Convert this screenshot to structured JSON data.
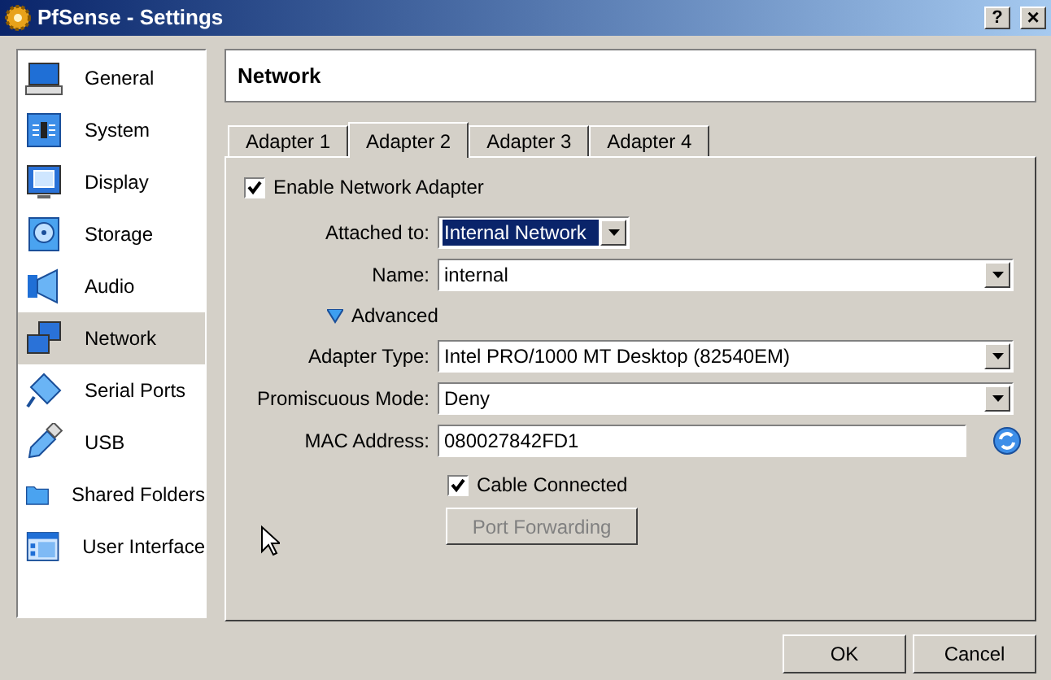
{
  "window": {
    "title": "PfSense - Settings",
    "help": "?",
    "close": "×"
  },
  "sidebar": {
    "items": [
      {
        "label": "General",
        "selected": false
      },
      {
        "label": "System",
        "selected": false
      },
      {
        "label": "Display",
        "selected": false
      },
      {
        "label": "Storage",
        "selected": false
      },
      {
        "label": "Audio",
        "selected": false
      },
      {
        "label": "Network",
        "selected": true
      },
      {
        "label": "Serial Ports",
        "selected": false
      },
      {
        "label": "USB",
        "selected": false
      },
      {
        "label": "Shared Folders",
        "selected": false
      },
      {
        "label": "User Interface",
        "selected": false
      }
    ]
  },
  "section_title": "Network",
  "tabs": [
    {
      "label": "Adapter 1",
      "selected": false
    },
    {
      "label": "Adapter 2",
      "selected": true
    },
    {
      "label": "Adapter 3",
      "selected": false
    },
    {
      "label": "Adapter 4",
      "selected": false
    }
  ],
  "enable_adapter": {
    "label": "Enable Network Adapter",
    "checked": true
  },
  "fields_top": [
    {
      "label": "Attached to:",
      "value": "Internal Network",
      "kind": "combo",
      "focused": true
    },
    {
      "label": "Name:",
      "value": "internal",
      "kind": "dropdown",
      "focused": false
    }
  ],
  "advanced": {
    "label": "Advanced",
    "expanded": true
  },
  "fields_advanced": [
    {
      "label": "Adapter Type:",
      "value": "Intel PRO/1000 MT Desktop (82540EM)",
      "kind": "dropdown",
      "focused": false
    },
    {
      "label": "Promiscuous Mode:",
      "value": "Deny",
      "kind": "dropdown",
      "focused": false
    },
    {
      "label": "MAC Address:",
      "value": "080027842FD1",
      "kind": "text",
      "focused": false
    }
  ],
  "cable_connected": {
    "label": "Cable Connected",
    "checked": true
  },
  "port_forwarding": {
    "label": "Port Forwarding",
    "disabled": true
  },
  "buttons": [
    "OK",
    "Cancel"
  ]
}
